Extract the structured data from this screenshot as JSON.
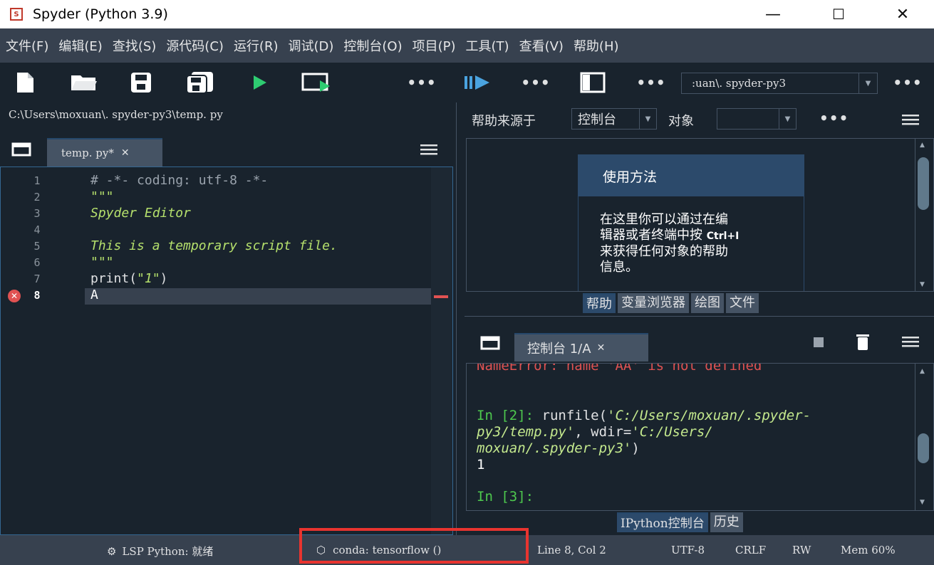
{
  "window": {
    "title": "Spyder (Python 3.9)",
    "minimize": "—",
    "maximize": "☐",
    "close": "✕"
  },
  "menubar": {
    "items": [
      "文件(F)",
      "编辑(E)",
      "查找(S)",
      "源代码(C)",
      "运行(R)",
      "调试(D)",
      "控制台(O)",
      "项目(P)",
      "工具(T)",
      "查看(V)",
      "帮助(H)"
    ]
  },
  "toolbar": {
    "more": "•••",
    "env_path": ":uan\\. spyder-py3"
  },
  "editor": {
    "filepath": "C:\\Users\\moxuan\\. spyder-py3\\temp. py",
    "tab_label": "temp. py*",
    "tab_close": "✕",
    "line_numbers": [
      "1",
      "2",
      "3",
      "4",
      "5",
      "6",
      "7",
      "8"
    ],
    "lines": {
      "l1": "# -*- coding: utf-8 -*-",
      "l2": "\"\"\"",
      "l3": "Spyder Editor",
      "l5": "This is a temporary script file.",
      "l6": "\"\"\"",
      "l7_fn": "print",
      "l7_open": "(",
      "l7_str": "\"1\"",
      "l7_close": ")",
      "l8": "A"
    },
    "error_icon": "✕"
  },
  "help": {
    "source_label": "帮助来源于",
    "source_value": "控制台",
    "object_label": "对象",
    "object_value": "",
    "usage_title": "使用方法",
    "usage_text_1": "在这里你可以通过在编",
    "usage_text_2a": "辑器或者终端中按 ",
    "usage_text_2b": "Ctrl+I",
    "usage_text_3": "来获得任何对象的帮助",
    "usage_text_4": "信息。",
    "tabs": [
      "帮助",
      "变量浏览器",
      "绘图",
      "文件"
    ]
  },
  "console": {
    "tab_label": "控制台 1/A",
    "tab_close": "✕",
    "error_line": "NameError: name 'AA' is not defined",
    "in2_prompt": "In [2]: ",
    "in2_cmd": "runfile(",
    "in2_arg1": "'C:/Users/moxuan/.spyder-",
    "in2_arg1b": "py3/temp.py'",
    "in2_mid": ", wdir=",
    "in2_arg2": "'C:/Users/",
    "in2_arg2b": "moxuan/.spyder-py3'",
    "in2_end": ")",
    "output": "1",
    "in3_prompt": "In [3]:",
    "tabs": [
      "IPython控制台",
      "历史"
    ]
  },
  "statusbar": {
    "lsp": "LSP Python: 就绪",
    "conda": "conda: tensorflow ()",
    "position": "Line 8, Col 2",
    "encoding": "UTF-8",
    "eol": "CRLF",
    "permissions": "RW",
    "memory": "Mem 60%"
  },
  "colors": {
    "background": "#19232d",
    "panel": "#37414f",
    "accent": "#26486b",
    "highlight_box": "#e8342f",
    "run_green": "#2ecc71",
    "debug_blue": "#4aa3df"
  }
}
